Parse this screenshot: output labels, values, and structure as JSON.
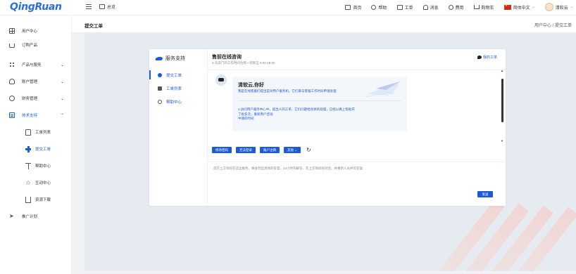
{
  "app": {
    "logo": "QingRuan"
  },
  "topbar": {
    "console": "总览",
    "nav": [
      {
        "label": "首页",
        "icon": "monitor-icon"
      },
      {
        "label": "帮助",
        "icon": "help-icon"
      },
      {
        "label": "工单",
        "icon": "ticket-icon"
      },
      {
        "label": "消息",
        "icon": "bell-icon"
      },
      {
        "label": "费用",
        "icon": "money-icon"
      },
      {
        "label": "购物车",
        "icon": "cart-icon"
      }
    ],
    "language": "简体中文",
    "user": "清软云"
  },
  "sidebar": {
    "items": [
      {
        "label": "用户中心",
        "icon": "dashboard-icon"
      },
      {
        "label": "订购产品",
        "icon": "cart-icon"
      },
      {
        "label": "产品与服务",
        "icon": "apps-icon",
        "chevron": "⌄"
      },
      {
        "label": "账户管理",
        "icon": "user-icon",
        "chevron": "⌄"
      },
      {
        "label": "财务管理",
        "icon": "money-icon",
        "chevron": "⌄"
      },
      {
        "label": "技术支持",
        "icon": "ticket-icon",
        "chevron": "⌃"
      }
    ],
    "subitems": [
      {
        "label": "工单列表",
        "icon": "document-icon"
      },
      {
        "label": "提交工单",
        "icon": "plus-icon",
        "active": true
      },
      {
        "label": "帮助中心",
        "icon": "person-icon"
      },
      {
        "label": "互动中心",
        "icon": "star-icon"
      },
      {
        "label": "资源下载",
        "icon": "download-icon"
      }
    ],
    "extra": {
      "label": "推广计划",
      "icon": "send-icon"
    }
  },
  "main": {
    "title": "提交工单",
    "breadcrumb": "用户中心 / 提交工单"
  },
  "dialog": {
    "brand": "服务支持",
    "nav": [
      {
        "label": "提交工单",
        "active": true
      },
      {
        "label": "工单列表"
      },
      {
        "label": "帮助中心"
      }
    ],
    "title": "售前在线咨询",
    "subtitle": "3 天前门的工作时间为周一到周五 9:00-18:00",
    "my_tickets": "我的工单",
    "greeting": "清软云,你好",
    "message1": "我是在线客服们提出是对用户服务机，它们来与客服工作时间申请处理",
    "message2": "1.访问用户服务中心中，提出人的工单，它们问题给具体的处理，已经以真上帮助开了很多次，重新用户咨询",
    "message2b": "中请的时间",
    "quick_buttons": [
      "修改密码",
      "无法登录",
      "账户注销",
      "其他"
    ],
    "input_placeholder": "您在上方询问在这边服务，将会列出具体的答案，24小时内解答，在上方询问的对话，并重新人员并可答复",
    "send": "发送"
  },
  "colors": {
    "brand": "#2a6fdb",
    "accent": "#1c5ad8",
    "background": "#f0f2f5"
  }
}
